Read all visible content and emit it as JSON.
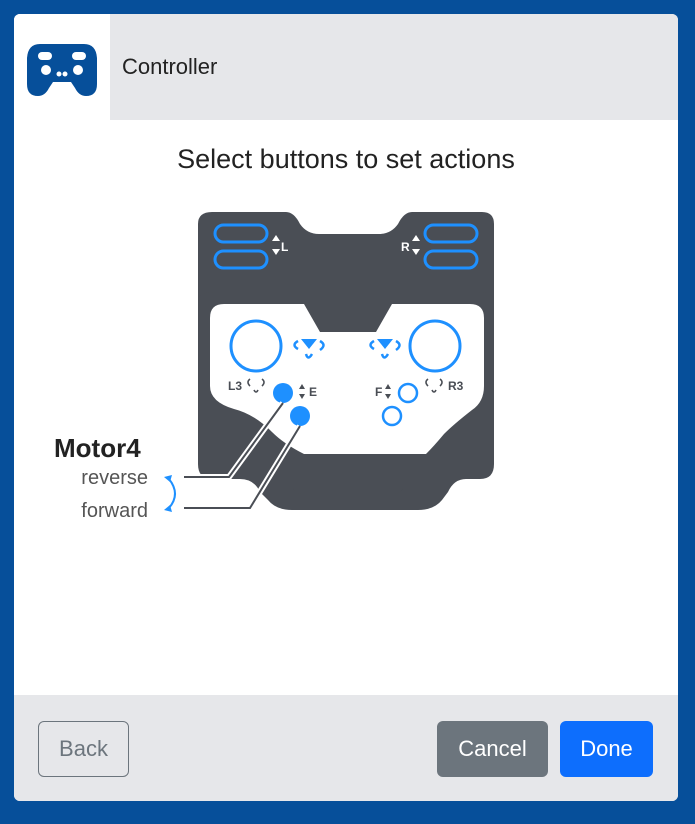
{
  "header": {
    "title": "Controller",
    "icon": "gamepad-icon"
  },
  "prompt": "Select buttons to set actions",
  "controller": {
    "labels": {
      "left_bumper": "L",
      "right_bumper": "R",
      "l3": "L3",
      "r3": "R3",
      "e_button": "E",
      "f_button": "F"
    }
  },
  "mapping": {
    "motor_name": "Motor4",
    "reverse_label": "reverse",
    "forward_label": "forward"
  },
  "footer": {
    "back_label": "Back",
    "cancel_label": "Cancel",
    "done_label": "Done"
  },
  "colors": {
    "accent": "#1e90ff",
    "controller_body": "#4a4e55",
    "frame": "#064f9a",
    "primary": "#0d6efd",
    "secondary": "#6c757d"
  }
}
